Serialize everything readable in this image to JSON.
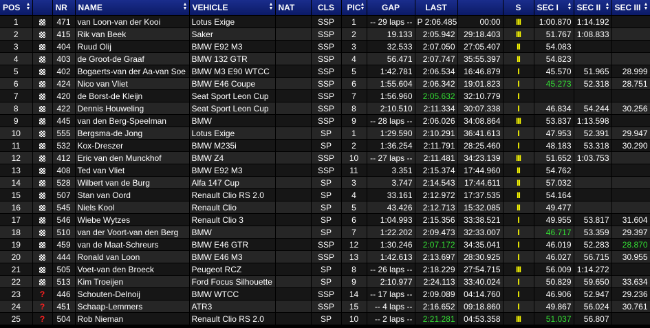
{
  "columns": [
    "POS",
    "NR",
    "NAME",
    "VEHICLE",
    "NAT",
    "CLS",
    "PIC",
    "GAP",
    "LAST",
    "S",
    "SEC I",
    "SEC II",
    "SEC III"
  ],
  "rows": [
    {
      "pos": "1",
      "icon": "flag",
      "nr": "471",
      "name": "van Loon-van der Kooi",
      "vehicle": "Lotus Exige",
      "nat": "",
      "cls": "SSP",
      "pic": "1",
      "gap": "-- 29 laps --",
      "last": "P 2:06.485",
      "time": "00:00",
      "s": "III",
      "s1": "1:00.870",
      "s2": "1:14.192",
      "s3": "",
      "last_green": false,
      "s1_green": false,
      "s2_green": false,
      "s3_green": false
    },
    {
      "pos": "2",
      "icon": "flag",
      "nr": "415",
      "name": "Rik van Beek",
      "vehicle": "Saker",
      "nat": "",
      "cls": "SSP",
      "pic": "2",
      "gap": "19.133",
      "last": "2:05.942",
      "time": "29:18.403",
      "s": "III",
      "s1": "51.767",
      "s2": "1:08.833",
      "s3": "",
      "last_green": false,
      "s1_green": false,
      "s2_green": false,
      "s3_green": false
    },
    {
      "pos": "3",
      "icon": "flag",
      "nr": "404",
      "name": "Ruud Olij",
      "vehicle": "BMW E92 M3",
      "nat": "",
      "cls": "SSP",
      "pic": "3",
      "gap": "32.533",
      "last": "2:07.050",
      "time": "27:05.407",
      "s": "II",
      "s1": "54.083",
      "s2": "",
      "s3": "",
      "last_green": false,
      "s1_green": false,
      "s2_green": false,
      "s3_green": false
    },
    {
      "pos": "4",
      "icon": "flag",
      "nr": "403",
      "name": "de Groot-de Graaf",
      "vehicle": "BMW 132 GTR",
      "nat": "",
      "cls": "SSP",
      "pic": "4",
      "gap": "56.471",
      "last": "2:07.747",
      "time": "35:55.397",
      "s": "II",
      "s1": "54.823",
      "s2": "",
      "s3": "",
      "last_green": false,
      "s1_green": false,
      "s2_green": false,
      "s3_green": false
    },
    {
      "pos": "5",
      "icon": "flag",
      "nr": "402",
      "name": "Bogaerts-van der Aa-van Soe",
      "vehicle": "BMW M3 E90 WTCC",
      "nat": "",
      "cls": "SSP",
      "pic": "5",
      "gap": "1:42.781",
      "last": "2:06.534",
      "time": "16:46.879",
      "s": "I",
      "s1": "45.570",
      "s2": "51.965",
      "s3": "28.999",
      "last_green": false,
      "s1_green": false,
      "s2_green": false,
      "s3_green": false
    },
    {
      "pos": "6",
      "icon": "flag",
      "nr": "424",
      "name": "Nico van Vliet",
      "vehicle": "BMW E46 Coupe",
      "nat": "",
      "cls": "SSP",
      "pic": "6",
      "gap": "1:55.604",
      "last": "2:06.342",
      "time": "19:01.823",
      "s": "I",
      "s1": "45.273",
      "s2": "52.318",
      "s3": "28.751",
      "last_green": false,
      "s1_green": true,
      "s2_green": false,
      "s3_green": false
    },
    {
      "pos": "7",
      "icon": "flag",
      "nr": "420",
      "name": "de Borst-de Kleijn",
      "vehicle": "Seat Sport Leon Cup",
      "nat": "",
      "cls": "SSP",
      "pic": "7",
      "gap": "1:56.960",
      "last": "2:05.632",
      "time": "32:10.779",
      "s": "I",
      "s1": "",
      "s2": "",
      "s3": "",
      "last_green": true,
      "s1_green": false,
      "s2_green": false,
      "s3_green": false
    },
    {
      "pos": "8",
      "icon": "flag",
      "nr": "422",
      "name": "Dennis Houweling",
      "vehicle": "Seat Sport Leon Cup",
      "nat": "",
      "cls": "SSP",
      "pic": "8",
      "gap": "2:10.510",
      "last": "2:11.334",
      "time": "30:07.338",
      "s": "I",
      "s1": "46.834",
      "s2": "54.244",
      "s3": "30.256",
      "last_green": false,
      "s1_green": false,
      "s2_green": false,
      "s3_green": false
    },
    {
      "pos": "9",
      "icon": "flag",
      "nr": "445",
      "name": "van den Berg-Speelman",
      "vehicle": "BMW",
      "nat": "",
      "cls": "SSP",
      "pic": "9",
      "gap": "-- 28 laps --",
      "last": "2:06.026",
      "time": "34:08.864",
      "s": "III",
      "s1": "53.837",
      "s2": "1:13.598",
      "s3": "",
      "last_green": false,
      "s1_green": false,
      "s2_green": false,
      "s3_green": false
    },
    {
      "pos": "10",
      "icon": "flag",
      "nr": "555",
      "name": "Bergsma-de Jong",
      "vehicle": "Lotus Exige",
      "nat": "",
      "cls": "SP",
      "pic": "1",
      "gap": "1:29.590",
      "last": "2:10.291",
      "time": "36:41.613",
      "s": "I",
      "s1": "47.953",
      "s2": "52.391",
      "s3": "29.947",
      "last_green": false,
      "s1_green": false,
      "s2_green": false,
      "s3_green": false
    },
    {
      "pos": "11",
      "icon": "flag",
      "nr": "532",
      "name": "Kox-Dreszer",
      "vehicle": "BMW M235i",
      "nat": "",
      "cls": "SP",
      "pic": "2",
      "gap": "1:36.254",
      "last": "2:11.791",
      "time": "28:25.460",
      "s": "I",
      "s1": "48.183",
      "s2": "53.318",
      "s3": "30.290",
      "last_green": false,
      "s1_green": false,
      "s2_green": false,
      "s3_green": false
    },
    {
      "pos": "12",
      "icon": "flag",
      "nr": "412",
      "name": "Eric van den Munckhof",
      "vehicle": "BMW Z4",
      "nat": "",
      "cls": "SSP",
      "pic": "10",
      "gap": "-- 27 laps --",
      "last": "2:11.481",
      "time": "34:23.139",
      "s": "III",
      "s1": "51.652",
      "s2": "1:03.753",
      "s3": "",
      "last_green": false,
      "s1_green": false,
      "s2_green": false,
      "s3_green": false
    },
    {
      "pos": "13",
      "icon": "flag",
      "nr": "408",
      "name": "Ted van Vliet",
      "vehicle": "BMW E92 M3",
      "nat": "",
      "cls": "SSP",
      "pic": "11",
      "gap": "3.351",
      "last": "2:15.374",
      "time": "17:44.960",
      "s": "II",
      "s1": "54.762",
      "s2": "",
      "s3": "",
      "last_green": false,
      "s1_green": false,
      "s2_green": false,
      "s3_green": false
    },
    {
      "pos": "14",
      "icon": "flag",
      "nr": "528",
      "name": "Wilbert van de Burg",
      "vehicle": "Alfa 147 Cup",
      "nat": "",
      "cls": "SP",
      "pic": "3",
      "gap": "3.747",
      "last": "2:14.543",
      "time": "17:44.611",
      "s": "II",
      "s1": "57.032",
      "s2": "",
      "s3": "",
      "last_green": false,
      "s1_green": false,
      "s2_green": false,
      "s3_green": false
    },
    {
      "pos": "15",
      "icon": "flag",
      "nr": "507",
      "name": "Stan van Oord",
      "vehicle": "Renault Clio RS 2.0",
      "nat": "",
      "cls": "SP",
      "pic": "4",
      "gap": "33.161",
      "last": "2:12.972",
      "time": "17:37.535",
      "s": "II",
      "s1": "54.164",
      "s2": "",
      "s3": "",
      "last_green": false,
      "s1_green": false,
      "s2_green": false,
      "s3_green": false
    },
    {
      "pos": "16",
      "icon": "flag",
      "nr": "545",
      "name": "Niels Kool",
      "vehicle": "Renault Clio",
      "nat": "",
      "cls": "SP",
      "pic": "5",
      "gap": "43.426",
      "last": "2:12.713",
      "time": "15:32.085",
      "s": "II",
      "s1": "49.477",
      "s2": "",
      "s3": "",
      "last_green": false,
      "s1_green": false,
      "s2_green": false,
      "s3_green": false
    },
    {
      "pos": "17",
      "icon": "flag",
      "nr": "546",
      "name": "Wiebe Wytzes",
      "vehicle": "Renault Clio 3",
      "nat": "",
      "cls": "SP",
      "pic": "6",
      "gap": "1:04.993",
      "last": "2:15.356",
      "time": "33:38.521",
      "s": "I",
      "s1": "49.955",
      "s2": "53.817",
      "s3": "31.604",
      "last_green": false,
      "s1_green": false,
      "s2_green": false,
      "s3_green": false
    },
    {
      "pos": "18",
      "icon": "flag",
      "nr": "510",
      "name": "van der Voort-van den Berg",
      "vehicle": "BMW",
      "nat": "",
      "cls": "SP",
      "pic": "7",
      "gap": "1:22.202",
      "last": "2:09.473",
      "time": "32:33.007",
      "s": "I",
      "s1": "46.717",
      "s2": "53.359",
      "s3": "29.397",
      "last_green": false,
      "s1_green": true,
      "s2_green": false,
      "s3_green": false
    },
    {
      "pos": "19",
      "icon": "flag",
      "nr": "459",
      "name": "van de Maat-Schreurs",
      "vehicle": "BMW E46 GTR",
      "nat": "",
      "cls": "SSP",
      "pic": "12",
      "gap": "1:30.246",
      "last": "2:07.172",
      "time": "34:35.041",
      "s": "I",
      "s1": "46.019",
      "s2": "52.283",
      "s3": "28.870",
      "last_green": true,
      "s1_green": false,
      "s2_green": false,
      "s3_green": true
    },
    {
      "pos": "20",
      "icon": "flag",
      "nr": "444",
      "name": "Ronald van Loon",
      "vehicle": "BMW E46 M3",
      "nat": "",
      "cls": "SSP",
      "pic": "13",
      "gap": "1:42.613",
      "last": "2:13.697",
      "time": "28:30.925",
      "s": "I",
      "s1": "46.027",
      "s2": "56.715",
      "s3": "30.955",
      "last_green": false,
      "s1_green": false,
      "s2_green": false,
      "s3_green": false
    },
    {
      "pos": "21",
      "icon": "flag",
      "nr": "505",
      "name": "Voet-van den Broeck",
      "vehicle": "Peugeot RCZ",
      "nat": "",
      "cls": "SP",
      "pic": "8",
      "gap": "-- 26 laps --",
      "last": "2:18.229",
      "time": "27:54.715",
      "s": "III",
      "s1": "56.009",
      "s2": "1:14.272",
      "s3": "",
      "last_green": false,
      "s1_green": false,
      "s2_green": false,
      "s3_green": false
    },
    {
      "pos": "22",
      "icon": "flag",
      "nr": "513",
      "name": "Kim Troeijen",
      "vehicle": "Ford Focus Silhouette",
      "nat": "",
      "cls": "SP",
      "pic": "9",
      "gap": "2:10.977",
      "last": "2:24.113",
      "time": "33:40.024",
      "s": "I",
      "s1": "50.829",
      "s2": "59.650",
      "s3": "33.634",
      "last_green": false,
      "s1_green": false,
      "s2_green": false,
      "s3_green": false
    },
    {
      "pos": "23",
      "icon": "question",
      "nr": "446",
      "name": "Schouten-Delnoij",
      "vehicle": "BMW WTCC",
      "nat": "",
      "cls": "SSP",
      "pic": "14",
      "gap": "-- 17 laps --",
      "last": "2:09.089",
      "time": "04:14.760",
      "s": "I",
      "s1": "46.906",
      "s2": "52.947",
      "s3": "29.236",
      "last_green": false,
      "s1_green": false,
      "s2_green": false,
      "s3_green": false
    },
    {
      "pos": "24",
      "icon": "question",
      "nr": "451",
      "name": "Schaap-Lemmers",
      "vehicle": "ATR3",
      "nat": "",
      "cls": "SSP",
      "pic": "15",
      "gap": "-- 4 laps --",
      "last": "2:16.652",
      "time": "09:18.860",
      "s": "I",
      "s1": "49.867",
      "s2": "56.024",
      "s3": "30.761",
      "last_green": false,
      "s1_green": false,
      "s2_green": false,
      "s3_green": false
    },
    {
      "pos": "25",
      "icon": "question",
      "nr": "504",
      "name": "Rob Nieman",
      "vehicle": "Renault Clio RS 2.0",
      "nat": "",
      "cls": "SP",
      "pic": "10",
      "gap": "-- 2 laps --",
      "last": "2:21.281",
      "time": "04:53.358",
      "s": "III",
      "s1": "51.037",
      "s2": "56.807",
      "s3": "",
      "last_green": true,
      "s1_green": true,
      "s2_green": false,
      "s3_green": false
    }
  ]
}
